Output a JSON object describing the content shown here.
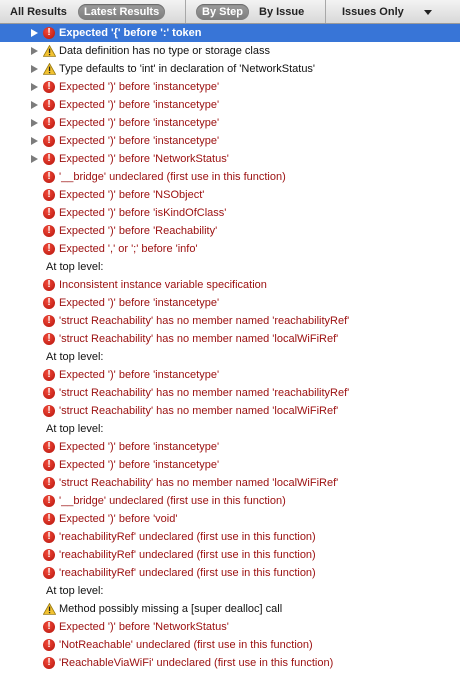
{
  "toolbar": {
    "all_results": "All Results",
    "latest_results": "Latest Results",
    "by_step": "By Step",
    "by_issue": "By Issue",
    "issues_only": "Issues Only"
  },
  "rows": [
    {
      "kind": "error",
      "text": "Expected '{' before ':' token",
      "disclosure": true
    },
    {
      "kind": "warning",
      "text": "Data definition has no type or storage class",
      "disclosure": true
    },
    {
      "kind": "warning",
      "text": "Type defaults to 'int' in declaration of 'NetworkStatus'",
      "disclosure": true
    },
    {
      "kind": "error",
      "text": "Expected ')' before 'instancetype'",
      "disclosure": true
    },
    {
      "kind": "error",
      "text": "Expected ')' before 'instancetype'",
      "disclosure": true
    },
    {
      "kind": "error",
      "text": "Expected ')' before 'instancetype'",
      "disclosure": true
    },
    {
      "kind": "error",
      "text": "Expected ')' before 'instancetype'",
      "disclosure": true
    },
    {
      "kind": "error",
      "text": "Expected ')' before 'NetworkStatus'",
      "disclosure": true
    },
    {
      "kind": "error",
      "text": "'__bridge' undeclared (first use in this function)"
    },
    {
      "kind": "error",
      "text": "Expected ')' before 'NSObject'"
    },
    {
      "kind": "error",
      "text": "Expected ')' before 'isKindOfClass'"
    },
    {
      "kind": "error",
      "text": "Expected ')' before 'Reachability'"
    },
    {
      "kind": "error",
      "text": "Expected ',' or ';' before 'info'"
    },
    {
      "kind": "section",
      "text": "At top level:"
    },
    {
      "kind": "error",
      "text": "Inconsistent instance variable specification"
    },
    {
      "kind": "error",
      "text": "Expected ')' before 'instancetype'"
    },
    {
      "kind": "error",
      "text": "'struct Reachability' has no member named 'reachabilityRef'"
    },
    {
      "kind": "error",
      "text": "'struct Reachability' has no member named 'localWiFiRef'"
    },
    {
      "kind": "section",
      "text": "At top level:"
    },
    {
      "kind": "error",
      "text": "Expected ')' before 'instancetype'"
    },
    {
      "kind": "error",
      "text": "'struct Reachability' has no member named 'reachabilityRef'"
    },
    {
      "kind": "error",
      "text": "'struct Reachability' has no member named 'localWiFiRef'"
    },
    {
      "kind": "section",
      "text": "At top level:"
    },
    {
      "kind": "error",
      "text": "Expected ')' before 'instancetype'"
    },
    {
      "kind": "error",
      "text": "Expected ')' before 'instancetype'"
    },
    {
      "kind": "error",
      "text": "'struct Reachability' has no member named 'localWiFiRef'"
    },
    {
      "kind": "error",
      "text": "'__bridge' undeclared (first use in this function)"
    },
    {
      "kind": "error",
      "text": "Expected ')' before 'void'"
    },
    {
      "kind": "error",
      "text": "'reachabilityRef' undeclared (first use in this function)"
    },
    {
      "kind": "error",
      "text": "'reachabilityRef' undeclared (first use in this function)"
    },
    {
      "kind": "error",
      "text": "'reachabilityRef' undeclared (first use in this function)"
    },
    {
      "kind": "section",
      "text": "At top level:"
    },
    {
      "kind": "warning",
      "text": "Method possibly missing a [super dealloc] call"
    },
    {
      "kind": "error",
      "text": "Expected ')' before 'NetworkStatus'"
    },
    {
      "kind": "error",
      "text": "'NotReachable' undeclared (first use in this function)"
    },
    {
      "kind": "error",
      "text": "'ReachableViaWiFi' undeclared (first use in this function)"
    }
  ],
  "selected_row": 0,
  "colors": {
    "selection": "#3875d7",
    "error_text": "#9b0f0f",
    "error_icon": "#d62314",
    "warning_icon": "#f2c230"
  }
}
